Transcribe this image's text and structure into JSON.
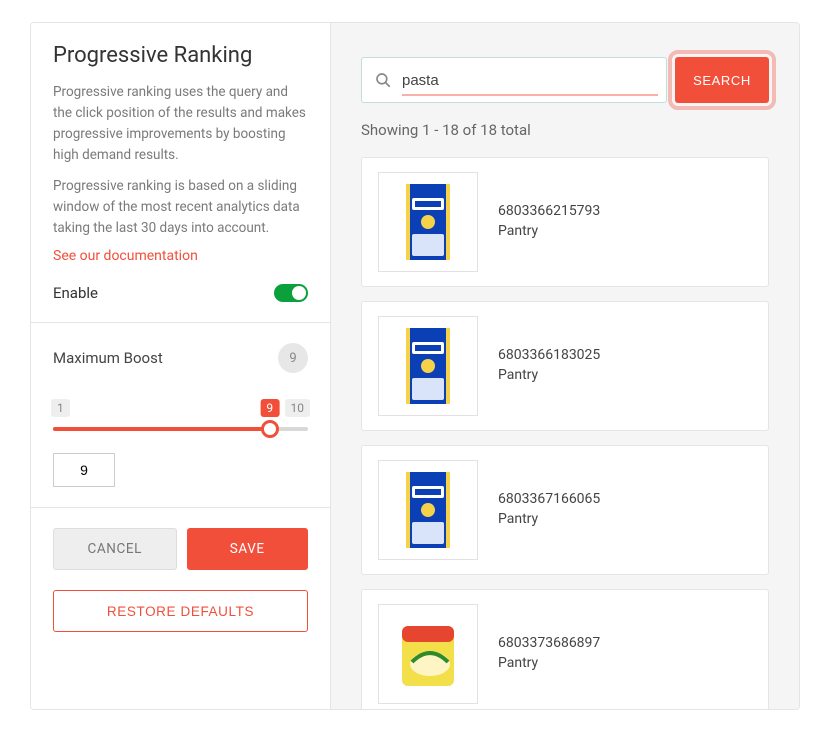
{
  "panel": {
    "title": "Progressive Ranking",
    "description1": "Progressive ranking uses the query and the click position of the results and makes progressive improvements by boosting high demand results.",
    "description2": "Progressive ranking is based on a sliding window of the most recent analytics data taking the last 30 days into account.",
    "doc_link": "See our documentation",
    "enable_label": "Enable",
    "max_boost_label": "Maximum Boost",
    "max_boost_badge": "9",
    "slider_min": "1",
    "slider_max": "10",
    "slider_value_bubble": "9",
    "slider_input_value": "9",
    "cancel": "CANCEL",
    "save": "SAVE",
    "restore": "RESTORE DEFAULTS"
  },
  "search": {
    "value": "pasta",
    "button": "SEARCH",
    "count_text": "Showing 1 - 18 of 18 total"
  },
  "results": [
    {
      "id": "6803366215793",
      "category": "Pantry",
      "thumb": "dececco-blue"
    },
    {
      "id": "6803366183025",
      "category": "Pantry",
      "thumb": "dececco-blue"
    },
    {
      "id": "6803367166065",
      "category": "Pantry",
      "thumb": "dececco-blue"
    },
    {
      "id": "6803373686897",
      "category": "Pantry",
      "thumb": "knorr-yellow"
    }
  ]
}
